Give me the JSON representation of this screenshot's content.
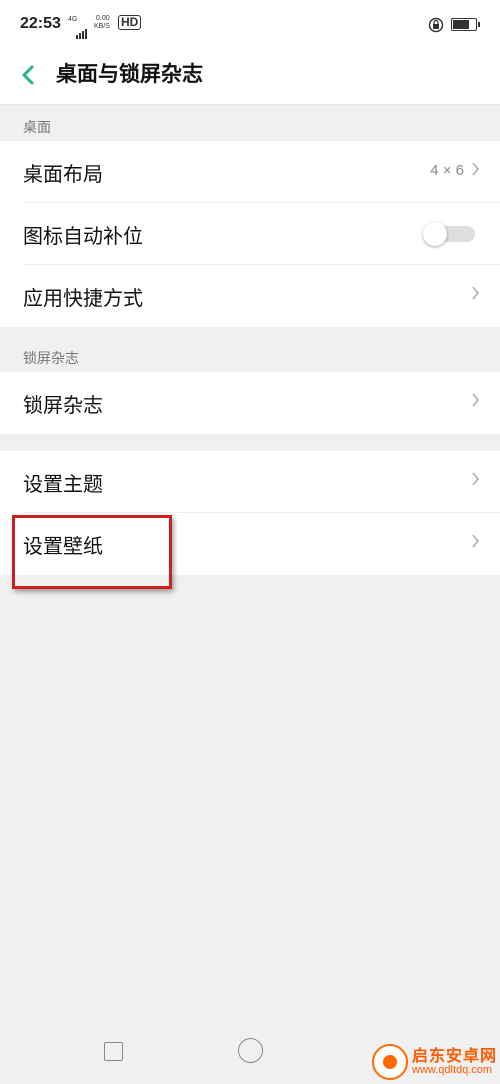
{
  "status_bar": {
    "time": "22:53",
    "network_type": "4G",
    "speed_value": "0.00",
    "speed_unit": "KB/S",
    "hd_label": "HD",
    "battery_level": 0.8
  },
  "header": {
    "title": "桌面与锁屏杂志"
  },
  "sections": {
    "desktop": {
      "title": "桌面",
      "layout_label": "桌面布局",
      "layout_value": "4 × 6",
      "auto_fill_label": "图标自动补位",
      "auto_fill_on": false,
      "shortcuts_label": "应用快捷方式"
    },
    "lockscreen": {
      "title": "锁屏杂志",
      "magazine_label": "锁屏杂志"
    },
    "other": {
      "theme_label": "设置主题",
      "wallpaper_label": "设置壁纸"
    }
  },
  "watermark": {
    "name": "启东安卓网",
    "url": "www.qdltdq.com"
  },
  "colors": {
    "accent": "#1fb87a",
    "highlight": "#cc1f1f",
    "watermark": "#ff5a00"
  }
}
